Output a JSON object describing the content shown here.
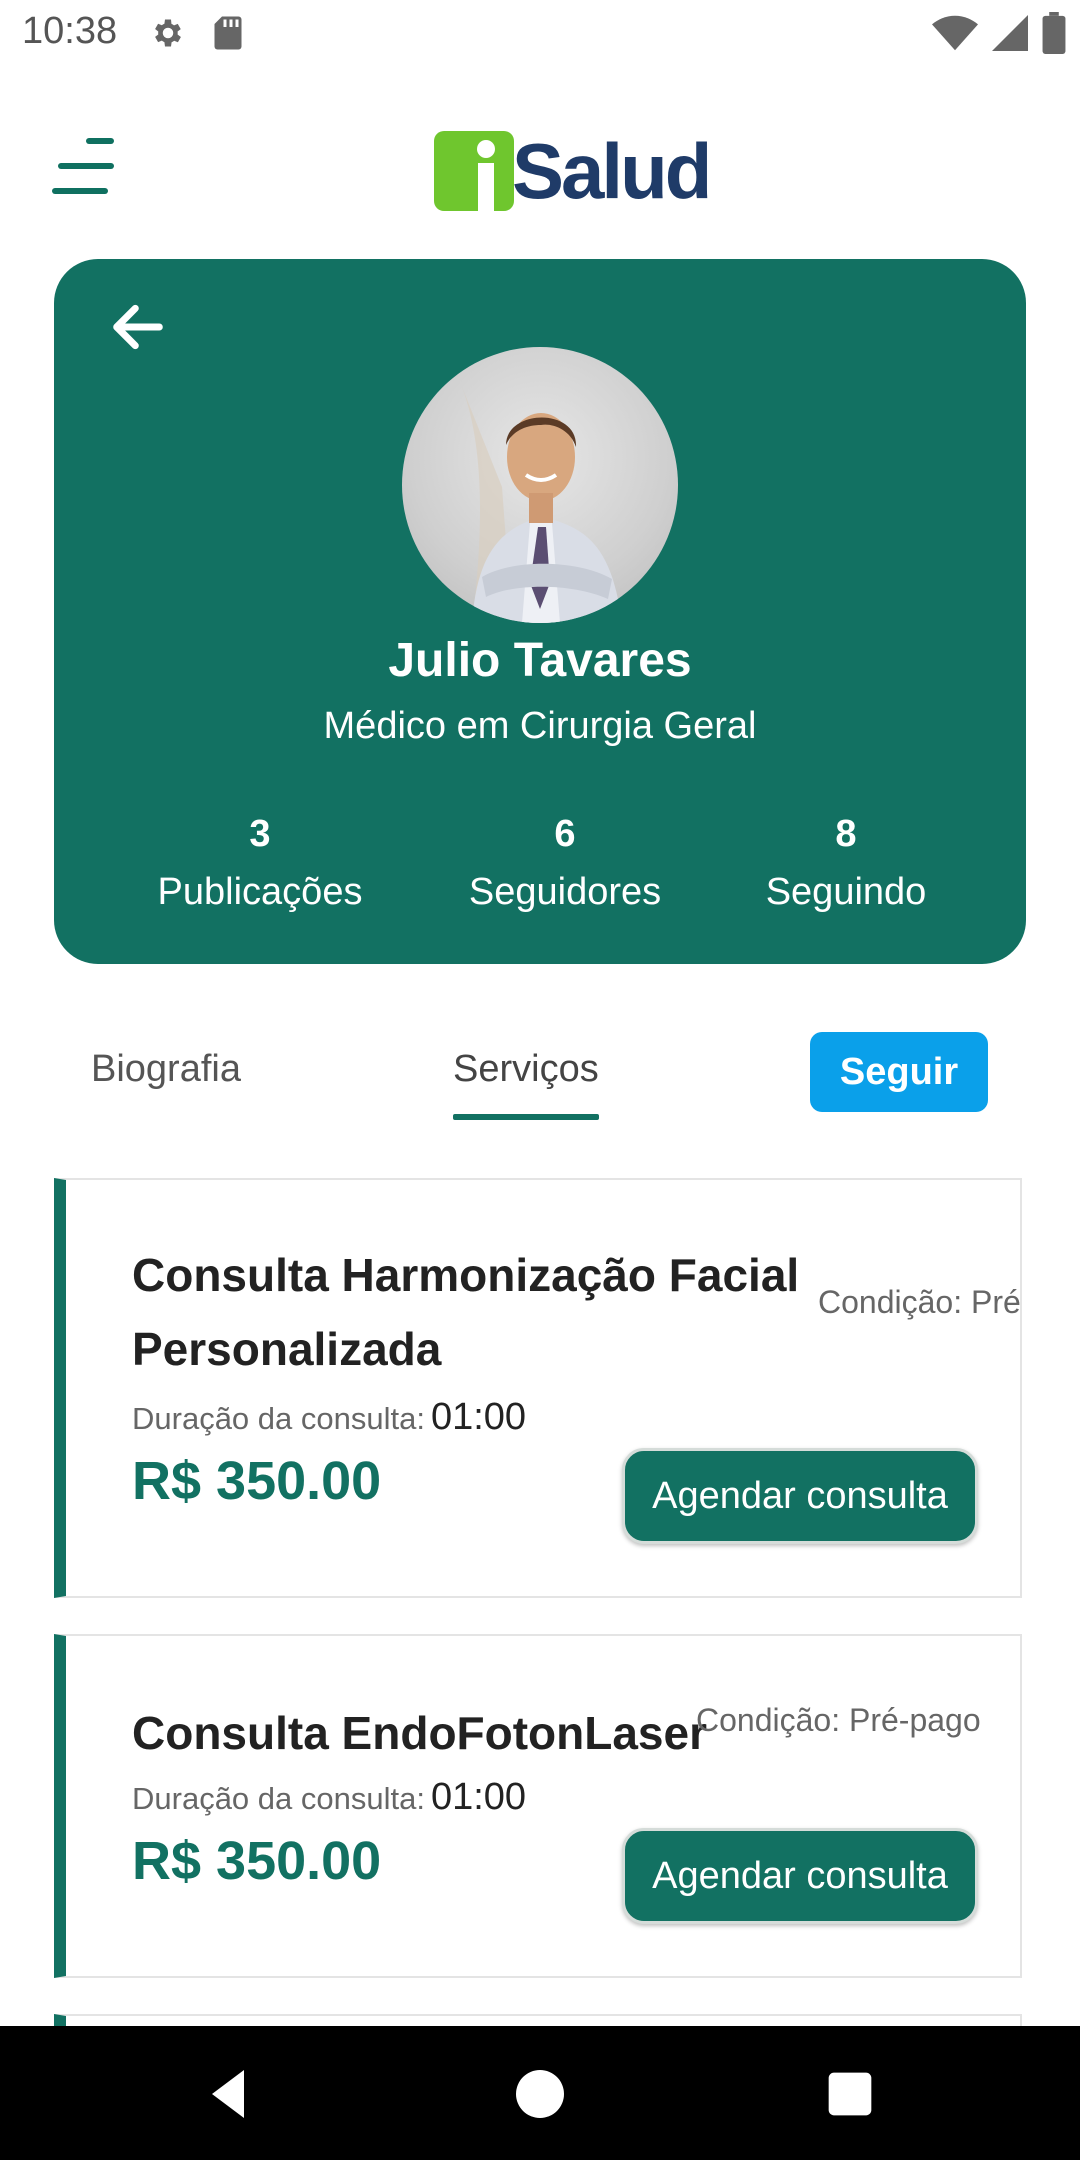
{
  "status_bar": {
    "time": "10:38",
    "icons": [
      "gear-icon",
      "sd-card-icon",
      "wifi-icon",
      "cell-signal-icon",
      "battery-icon"
    ]
  },
  "header": {
    "menu_icon": "hamburger-menu-icon",
    "logo_text": "Salud"
  },
  "profile": {
    "name": "Julio Tavares",
    "specialty": "Médico em Cirurgia Geral",
    "stats": [
      {
        "value": "3",
        "label": "Publicações"
      },
      {
        "value": "6",
        "label": "Seguidores"
      },
      {
        "value": "8",
        "label": "Seguindo"
      }
    ]
  },
  "tabs": {
    "biography": "Biografia",
    "services": "Serviços",
    "active": "services",
    "follow_label": "Seguir"
  },
  "services": [
    {
      "title": "Consulta Harmonização Facial Personalizada",
      "condition": "Condição: Pré-",
      "duration_label": "Duração da consulta:",
      "duration_value": "01:00",
      "price": "R$ 350.00",
      "button": "Agendar consulta"
    },
    {
      "title": "Consulta EndoFotonLaser",
      "condition": "Condição: Pré-pago",
      "duration_label": "Duração da consulta:",
      "duration_value": "01:00",
      "price": "R$ 350.00",
      "button": "Agendar consulta"
    }
  ],
  "colors": {
    "primary": "#127162",
    "follow": "#0aa0ea",
    "logo_green": "#6fc62e",
    "logo_blue": "#1f3b68"
  }
}
